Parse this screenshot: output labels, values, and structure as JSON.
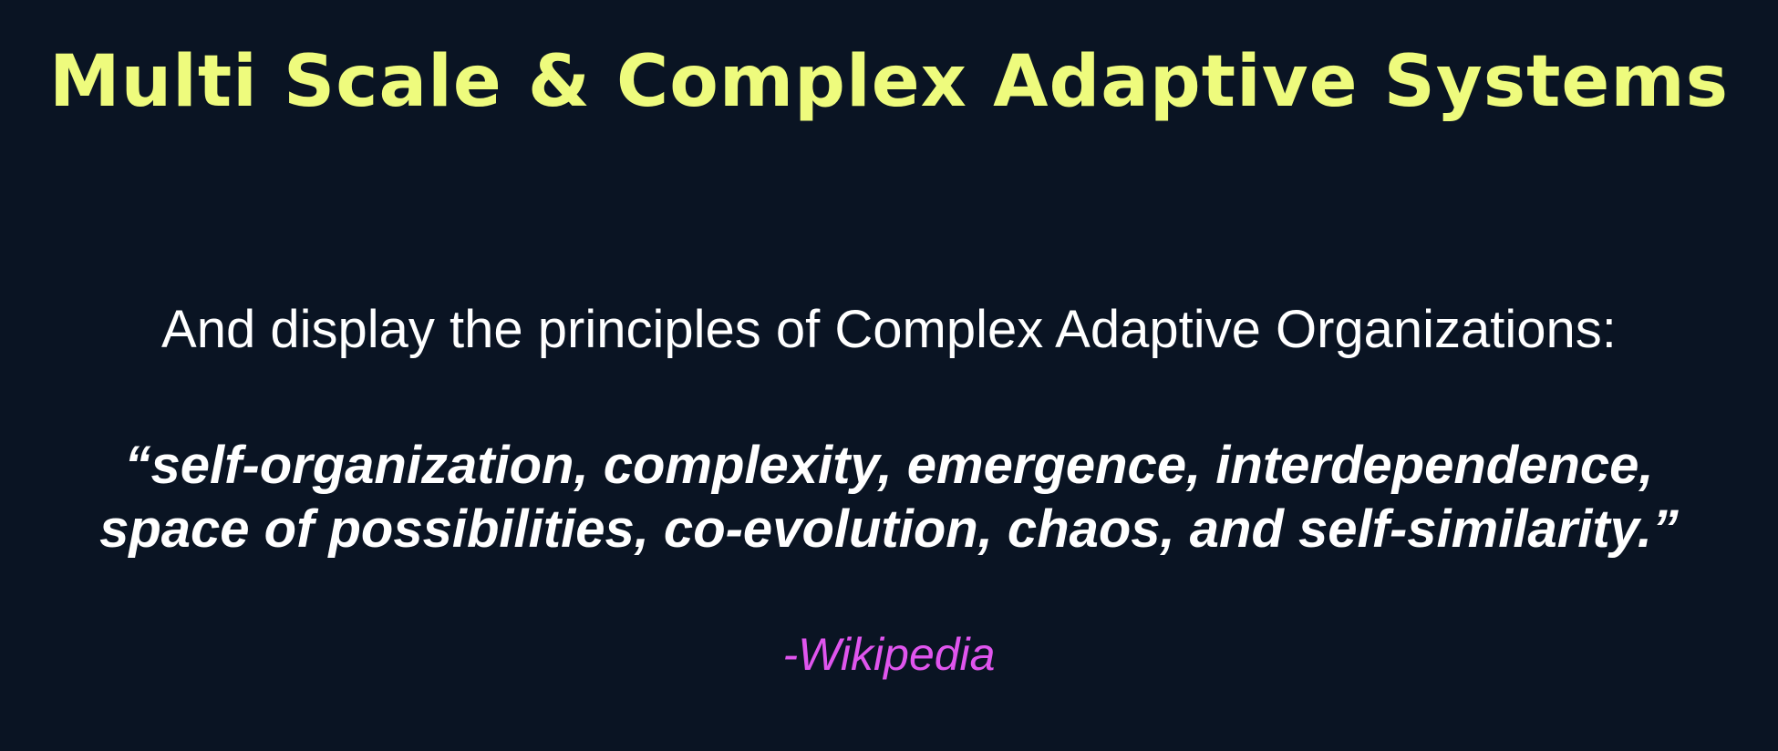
{
  "slide": {
    "title": "Multi Scale & Complex Adaptive Systems",
    "intro": "And display the principles of Complex Adaptive Organizations:",
    "quote_line_1": "“self-organization, complexity, emergence, interdependence,",
    "quote_line_2": "space of possibilities, co-evolution, chaos, and self-similarity.”",
    "attribution": "-Wikipedia"
  },
  "colors": {
    "background": "#0a1423",
    "title": "#eefb7d",
    "body_text": "#ffffff",
    "attribution": "#e055ee"
  }
}
